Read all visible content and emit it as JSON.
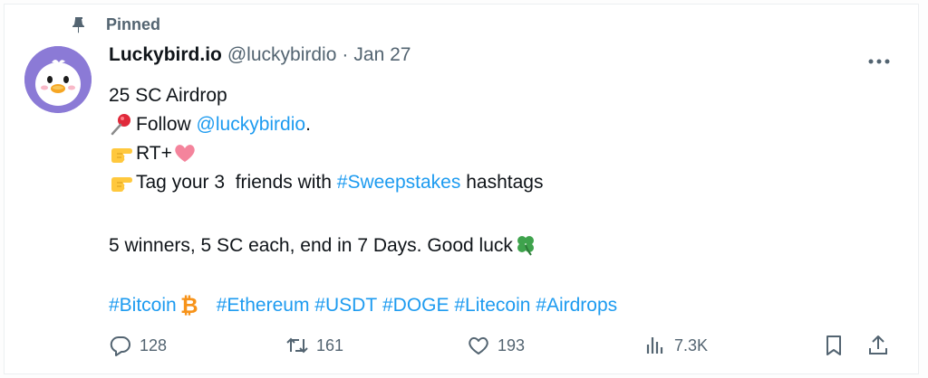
{
  "pinned": {
    "label": "Pinned",
    "icon": "pin-icon"
  },
  "author": {
    "display_name": "Luckybird.io",
    "handle": "@luckybirdio",
    "separator": "·",
    "date": "Jan 27",
    "avatar_icon": "duck-avatar"
  },
  "more_icon": "more-horizontal-icon",
  "post": {
    "line1": "25 SC Airdrop",
    "line2_prefix": "Follow ",
    "line2_mention": "@luckybirdio",
    "line2_suffix": ".",
    "line3_prefix": "RT+",
    "line4_prefix": "Tag your 3  friends with ",
    "line4_hashtag": "#Sweepstakes",
    "line4_suffix": " hashtags",
    "line5": "5 winners, 5 SC each, end in 7 Days. Good luck",
    "hashtags": {
      "bitcoin": "#Bitcoin",
      "ethereum": "#Ethereum",
      "usdt": "#USDT",
      "doge": "#DOGE",
      "litecoin": "#Litecoin",
      "airdrops": "#Airdrops"
    },
    "emojis": [
      "pushpin",
      "pointing-right-hand",
      "pink-heart",
      "pointing-right-hand",
      "four-leaf-clover",
      "bitcoin-symbol"
    ]
  },
  "actions": {
    "replies": "128",
    "reposts": "161",
    "likes": "193",
    "views": "7.3K"
  },
  "colors": {
    "link": "#1d9bf0",
    "secondary_text": "#536471",
    "primary_text": "#0f1419",
    "avatar_bg": "#8b7ad6",
    "bitcoin": "#f7931a",
    "clover": "#3fa34d",
    "heart": "#f4849c"
  }
}
